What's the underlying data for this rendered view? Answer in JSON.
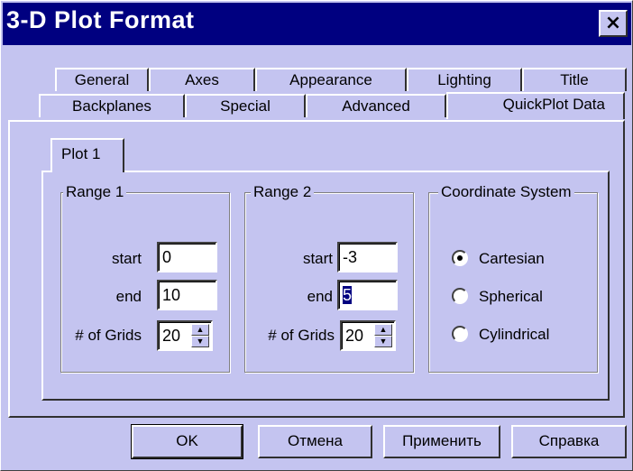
{
  "window": {
    "title": "3-D Plot Format",
    "close_icon": "×"
  },
  "tabs_row1": [
    "General",
    "Axes",
    "Appearance",
    "Lighting",
    "Title"
  ],
  "tabs_row2": [
    "Backplanes",
    "Special",
    "Advanced",
    "QuickPlot Data"
  ],
  "active_tab": "QuickPlot Data",
  "subtab": "Plot 1",
  "range1": {
    "legend": "Range 1",
    "start_label": "start",
    "start_value": "0",
    "end_label": "end",
    "end_value": "10",
    "grids_label": "# of Grids",
    "grids_value": "20"
  },
  "range2": {
    "legend": "Range 2",
    "start_label": "start",
    "start_value": "-3",
    "end_label": "end",
    "end_value": "5",
    "grids_label": "# of Grids",
    "grids_value": "20"
  },
  "coord": {
    "legend": "Coordinate System",
    "options": [
      "Cartesian",
      "Spherical",
      "Cylindrical"
    ],
    "selected": "Cartesian"
  },
  "buttons": {
    "ok": "OK",
    "cancel": "Отмена",
    "apply": "Применить",
    "help": "Справка"
  },
  "colors": {
    "face": "#c4c4f0",
    "titlebar": "#000080"
  }
}
